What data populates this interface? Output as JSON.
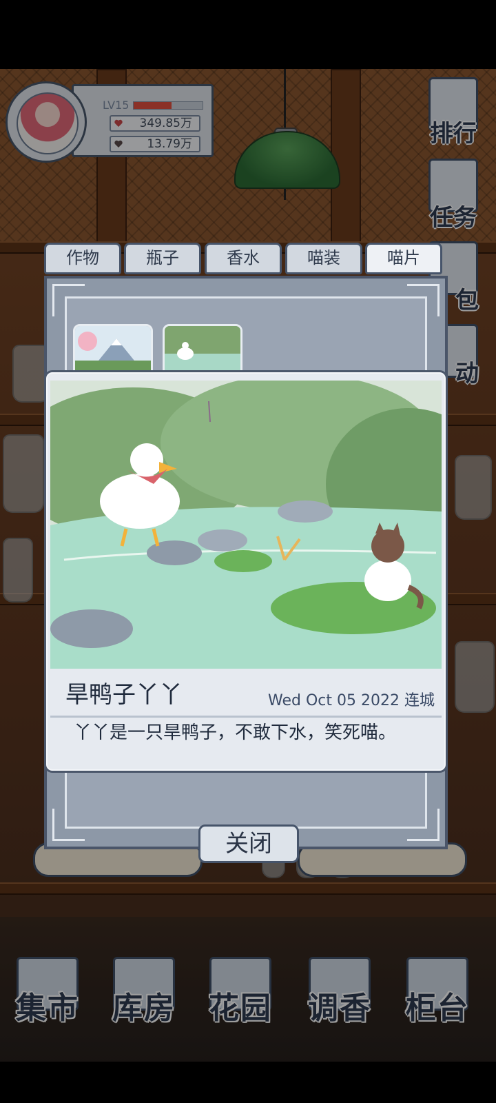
{
  "hud": {
    "level": "LV15",
    "exp_fraction": 0.55,
    "currency_primary": "349.85万",
    "currency_secondary": "13.79万"
  },
  "side_menu": [
    "排行",
    "任务",
    "包",
    "动"
  ],
  "collection": {
    "tabs": [
      "作物",
      "瓶子",
      "香水",
      "喵装",
      "喵片"
    ],
    "active_tab": "喵片",
    "close_label": "关闭"
  },
  "card": {
    "title": "旱鸭子丫丫",
    "meta": "Wed Oct 05 2022 连城",
    "description": "丫丫是一只旱鸭子，不敢下水，笑死喵。"
  },
  "bottom_nav": [
    "集市",
    "库房",
    "花园",
    "调香",
    "柜台"
  ],
  "colors": {
    "frame": "#4b576b",
    "panel_bg": "#e6eaf0",
    "text_dark": "#1f2a3c",
    "exp_bar": "#e05040"
  }
}
